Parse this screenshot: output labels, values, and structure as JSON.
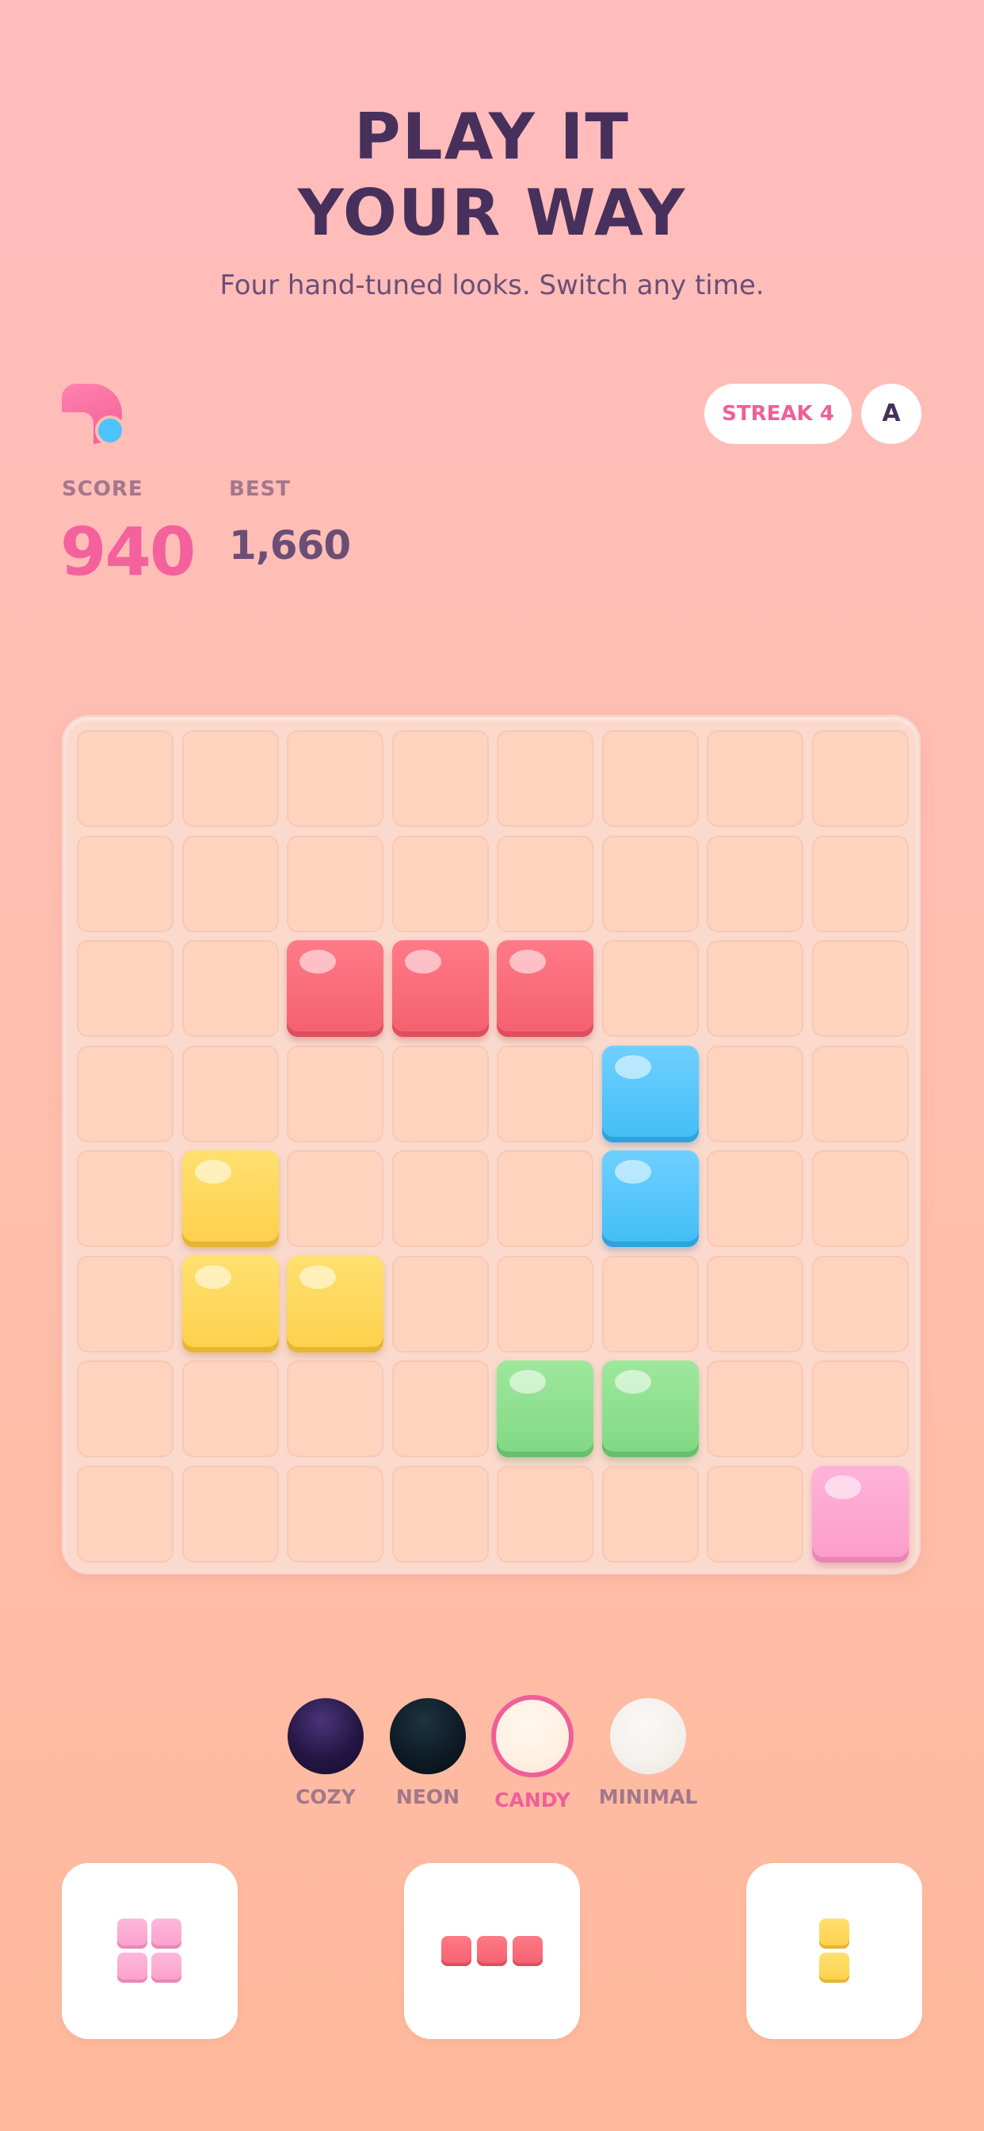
{
  "hero": {
    "title_line1": "PLAY IT",
    "title_line2": "YOUR WAY",
    "subtitle": "Four hand-tuned looks. Switch any time."
  },
  "header": {
    "logo_icon": "block-logo-icon",
    "streak_label": "STREAK 4",
    "avatar_initial": "A"
  },
  "stats": {
    "score_label": "SCORE",
    "score_value": "940",
    "best_label": "BEST",
    "best_value": "1,660"
  },
  "board": {
    "rows": 8,
    "cols": 8,
    "tiles": [
      {
        "row": 2,
        "col": 2,
        "color": "red"
      },
      {
        "row": 2,
        "col": 3,
        "color": "red"
      },
      {
        "row": 2,
        "col": 4,
        "color": "red"
      },
      {
        "row": 3,
        "col": 5,
        "color": "blue"
      },
      {
        "row": 4,
        "col": 1,
        "color": "yellow"
      },
      {
        "row": 4,
        "col": 5,
        "color": "blue"
      },
      {
        "row": 5,
        "col": 1,
        "color": "yellow"
      },
      {
        "row": 5,
        "col": 2,
        "color": "yellow"
      },
      {
        "row": 6,
        "col": 4,
        "color": "green"
      },
      {
        "row": 6,
        "col": 5,
        "color": "green"
      },
      {
        "row": 7,
        "col": 7,
        "color": "pink"
      }
    ]
  },
  "themes": {
    "selected": "CANDY",
    "items": [
      {
        "label": "COZY",
        "swatch": "#2a1d4f"
      },
      {
        "label": "NEON",
        "swatch": "#0d1a24"
      },
      {
        "label": "CANDY",
        "swatch": "#fff1e4"
      },
      {
        "label": "MINIMAL",
        "swatch": "#f4f0ec"
      }
    ]
  },
  "tray": {
    "pieces": [
      {
        "shape": "square-2x2",
        "color": "pink"
      },
      {
        "shape": "line-3x1",
        "color": "red"
      },
      {
        "shape": "line-1x2",
        "color": "yellow"
      }
    ]
  },
  "colors": {
    "accent": "#ef5f98",
    "title": "#47305b",
    "tile_red": "#f4606f",
    "tile_blue": "#41bdf6",
    "tile_yellow": "#fdd04a",
    "tile_green": "#80d883",
    "tile_pink": "#fb9cc9"
  }
}
